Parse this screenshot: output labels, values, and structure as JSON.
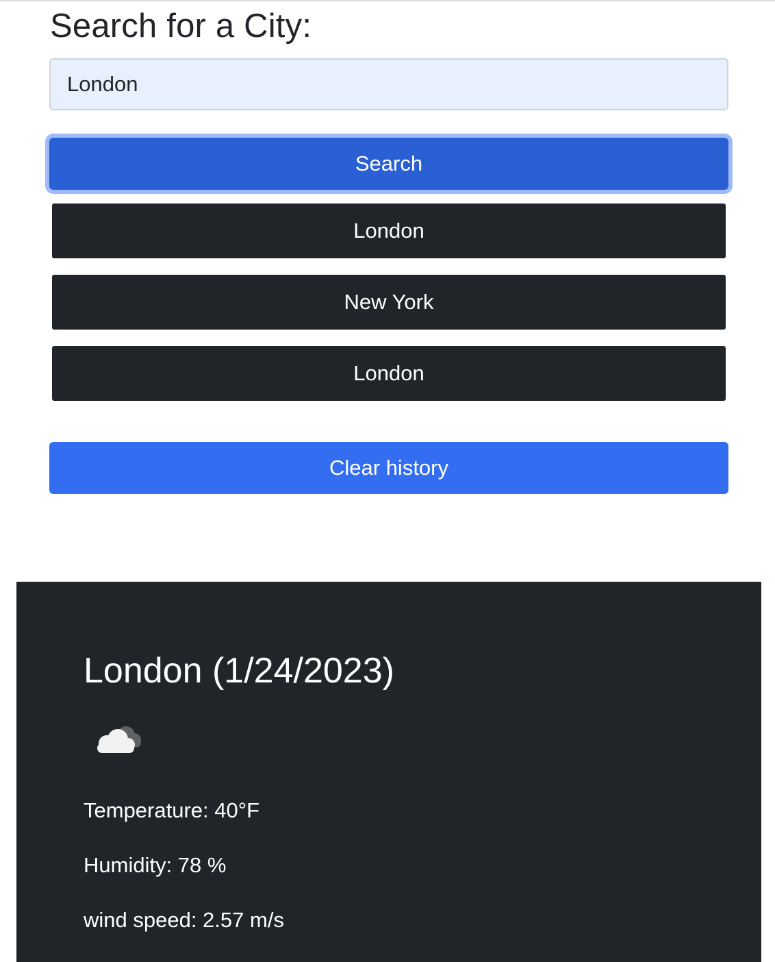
{
  "search": {
    "heading": "Search for a City:",
    "input_value": "London",
    "button_label": "Search"
  },
  "history": {
    "items": [
      {
        "label": "London"
      },
      {
        "label": "New York"
      },
      {
        "label": "London"
      }
    ],
    "clear_label": "Clear history"
  },
  "weather": {
    "title": "London (1/24/2023)",
    "icon": "cloud-icon",
    "temperature": "Temperature: 40°F",
    "humidity": "Humidity: 78 %",
    "wind_speed": "wind speed: 2.57 m/s"
  },
  "colors": {
    "search_button": "#2b5fd4",
    "history_button": "#212529",
    "clear_button": "#336ef2",
    "panel_background": "#212529",
    "input_background": "#e8f0fe"
  }
}
